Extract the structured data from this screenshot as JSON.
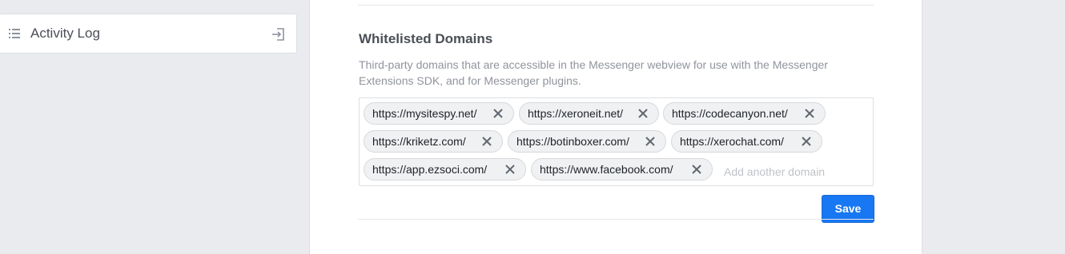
{
  "sidebar": {
    "activity_log": {
      "label": "Activity Log",
      "icon": "list-icon",
      "action_icon": "exit-icon"
    }
  },
  "whitelist": {
    "title": "Whitelisted Domains",
    "description": "Third-party domains that are accessible in the Messenger webview for use with the Messenger Extensions SDK, and for Messenger plugins.",
    "domains": [
      "https://mysitespy.net/",
      "https://xeroneit.net/",
      "https://codecanyon.net/",
      "https://kriketz.com/",
      "https://botinboxer.com/",
      "https://xerochat.com/",
      "https://app.ezsoci.com/",
      "https://www.facebook.com/"
    ],
    "input": {
      "placeholder": "Add another domain",
      "value": ""
    },
    "save_label": "Save"
  },
  "colors": {
    "accent": "#1877f2",
    "page_bg": "#e9ebee",
    "tag_bg": "#f0f1f2"
  }
}
